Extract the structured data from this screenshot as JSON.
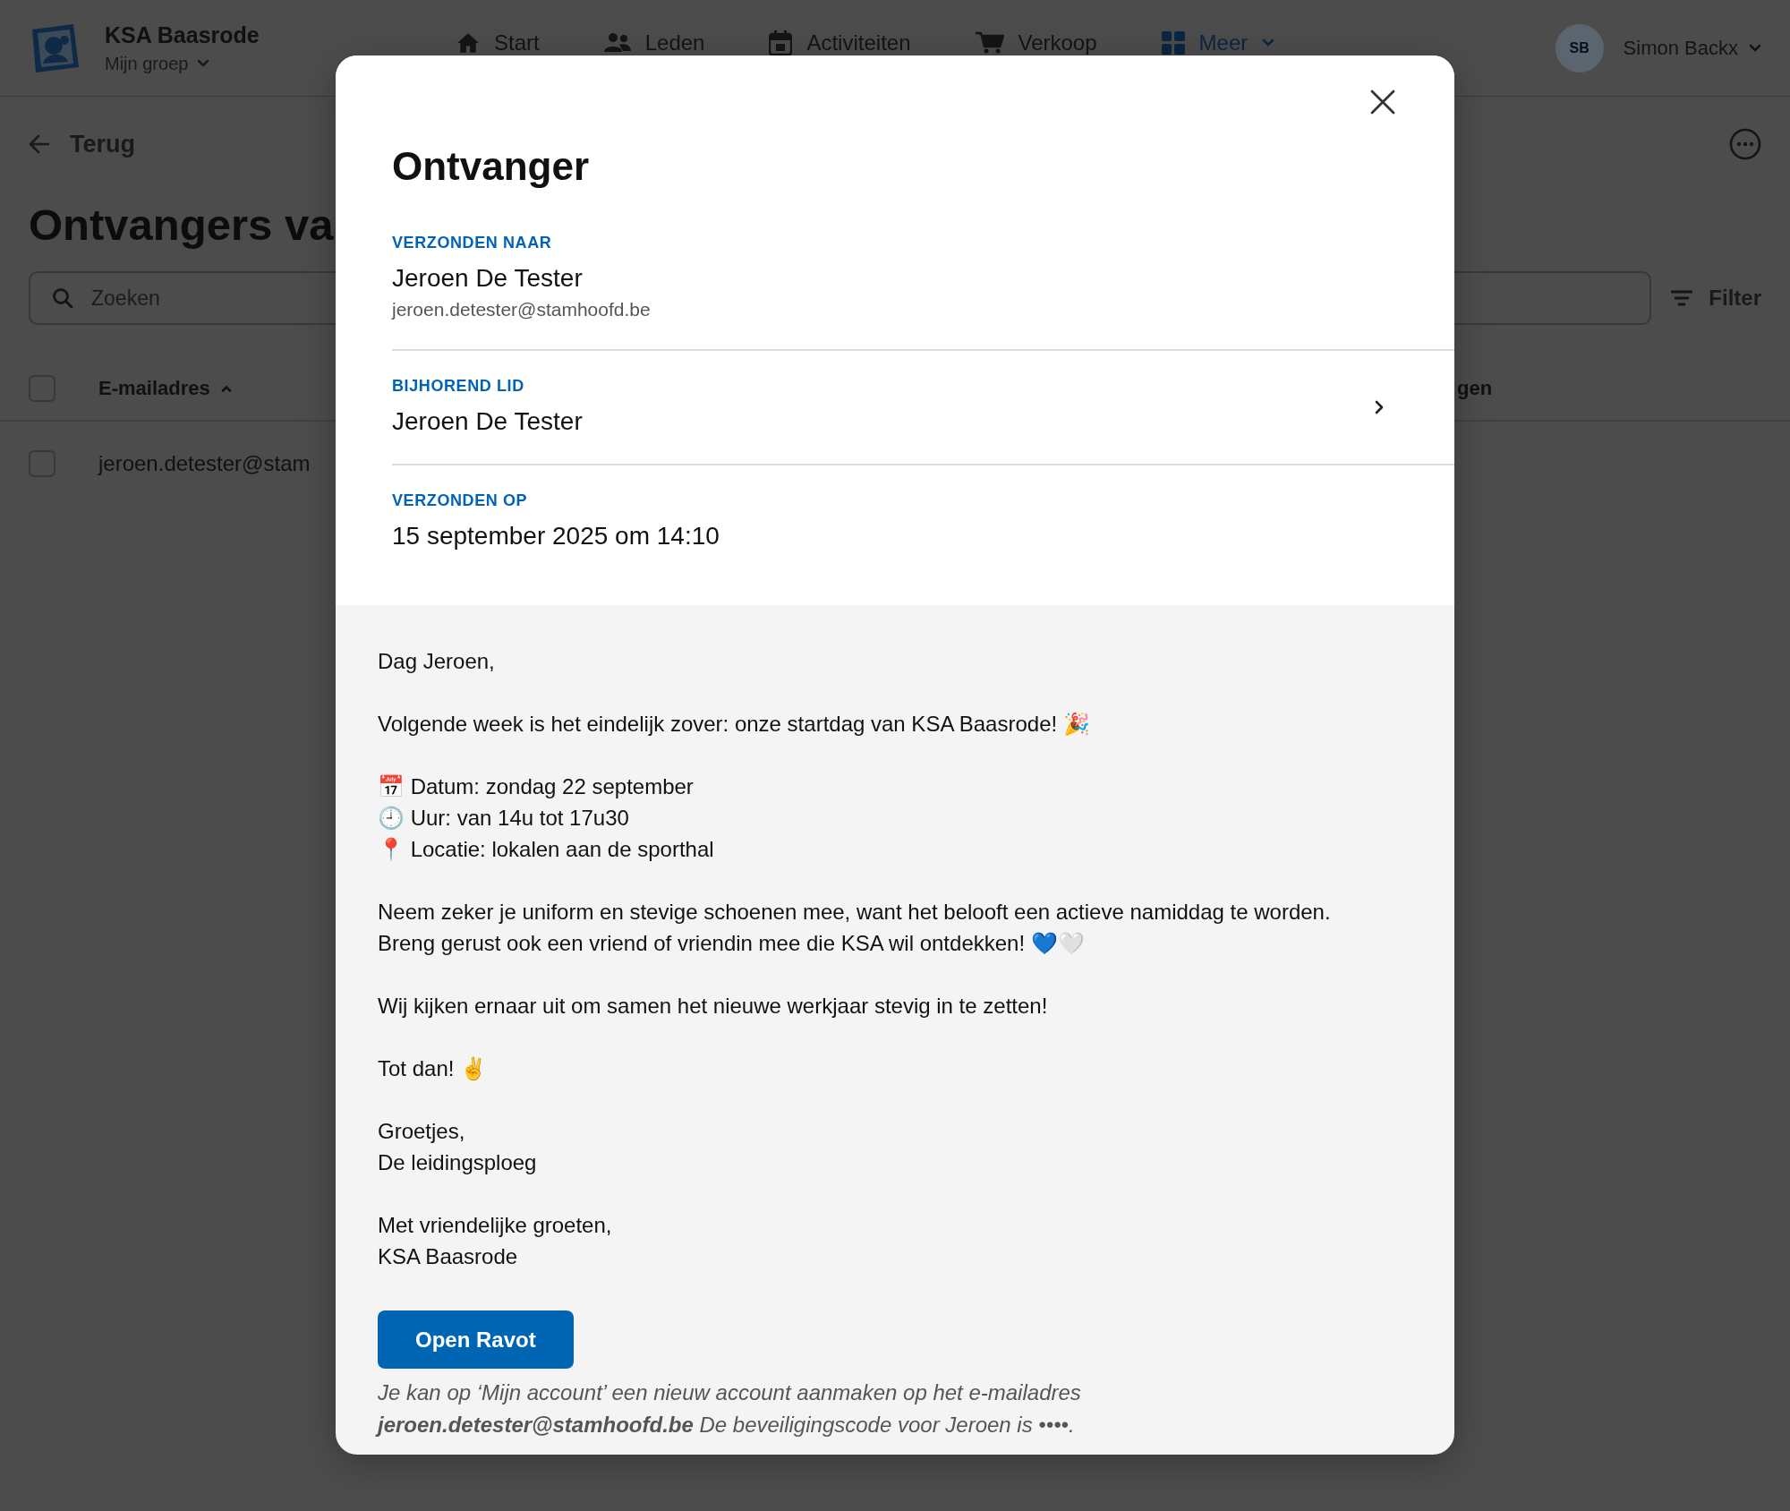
{
  "topbar": {
    "organization": "KSA Baasrode",
    "group_switcher": "Mijn groep",
    "nav": [
      {
        "label": "Start",
        "selected": false,
        "dropdown": false
      },
      {
        "label": "Leden",
        "selected": false,
        "dropdown": false
      },
      {
        "label": "Activiteiten",
        "selected": false,
        "dropdown": false
      },
      {
        "label": "Verkoop",
        "selected": false,
        "dropdown": false
      },
      {
        "label": "Meer",
        "selected": true,
        "dropdown": true
      }
    ],
    "user": {
      "initials": "SB",
      "name": "Simon Backx"
    }
  },
  "page": {
    "back": "Terug",
    "title": "Ontvangers va",
    "search": {
      "placeholder": "Zoeken"
    },
    "filter": "Filter",
    "table": {
      "select_all": {
        "checked": false
      },
      "columns": [
        {
          "label": "E-mailadres",
          "sorted": true
        },
        {
          "label": "gen",
          "sorted": false
        }
      ],
      "rows": [
        {
          "checked": false,
          "cells": [
            "jeroen.detester@stam"
          ]
        }
      ]
    }
  },
  "modal": {
    "title": "Ontvanger",
    "sections": [
      {
        "label": "VERZONDEN NAAR",
        "value": "Jeroen De Tester",
        "detail": "jeroen.detester@stamhoofd.be",
        "link": false
      },
      {
        "label": "BIJHOREND LID",
        "value": "Jeroen De Tester",
        "link": true
      },
      {
        "label": "VERZONDEN OP",
        "value": "15 september 2025 om 14:10",
        "link": false
      }
    ],
    "email": {
      "paragraphs": [
        [
          "Dag Jeroen,"
        ],
        [
          "Volgende week is het eindelijk zover: onze startdag van KSA Baasrode! 🎉"
        ],
        [
          "📅 Datum: zondag 22 september",
          "🕘 Uur: van 14u tot 17u30",
          "📍 Locatie: lokalen aan de sporthal"
        ],
        [
          "Neem zeker je uniform en stevige schoenen mee, want het belooft een actieve namiddag te worden.",
          "Breng gerust ook een vriend of vriendin mee die KSA wil ontdekken! 💙🤍"
        ],
        [
          "Wij kijken ernaar uit om samen het nieuwe werkjaar stevig in te zetten!"
        ],
        [
          "Tot dan! ✌️"
        ],
        [
          "Groetjes,",
          "De leidingsploeg"
        ],
        [
          "Met vriendelijke groeten,",
          "KSA Baasrode"
        ]
      ],
      "button": "Open Ravot",
      "footnote": "Je kan op ‘Mijn account’ een nieuw account aanmaken op het e-mailadres **jeroen.detester@stamhoofd.be** De beveiligingscode voor Jeroen is ••••."
    }
  }
}
